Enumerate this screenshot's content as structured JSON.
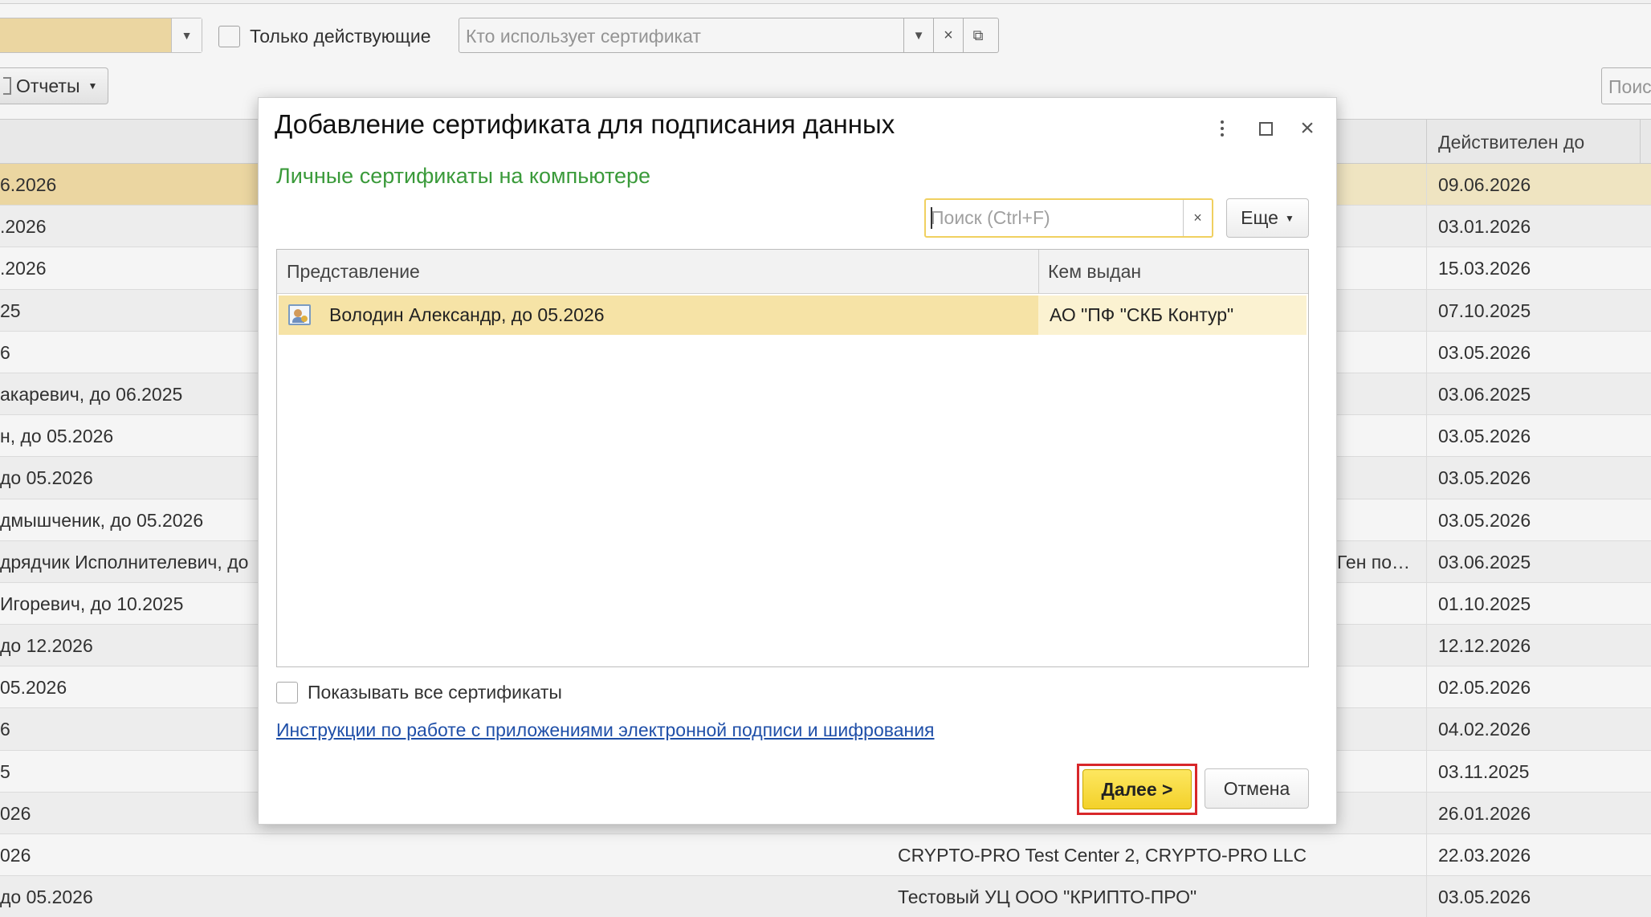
{
  "background": {
    "filter_only_active_label": "Только действующие",
    "who_uses_placeholder": "Кто использует сертификат",
    "reports_label": "Отчеты",
    "right_search_placeholder": "Поис",
    "valid_until_header": "Действителен до",
    "rows": [
      {
        "name": "6.2026",
        "issuer": "",
        "date": "09.06.2026",
        "selected": true
      },
      {
        "name": ".2026",
        "issuer": "",
        "date": "03.01.2026"
      },
      {
        "name": ".2026",
        "issuer": "",
        "date": "15.03.2026"
      },
      {
        "name": "25",
        "issuer": "",
        "date": "07.10.2025"
      },
      {
        "name": "6",
        "issuer": "",
        "date": "03.05.2026"
      },
      {
        "name": "акаревич, до 06.2025",
        "issuer": "",
        "date": "03.06.2025"
      },
      {
        "name": "н, до 05.2026",
        "issuer": "",
        "date": "03.05.2026"
      },
      {
        "name": "до 05.2026",
        "issuer": "",
        "date": "03.05.2026"
      },
      {
        "name": "дмышченик, до 05.2026",
        "issuer": "",
        "date": "03.05.2026"
      },
      {
        "name": "дрядчик Исполнителевич, до",
        "issuer": "Ген по…",
        "date": "03.06.2025",
        "issuer_right": true
      },
      {
        "name": "Игоревич, до 10.2025",
        "issuer": "",
        "date": "01.10.2025"
      },
      {
        "name": "до 12.2026",
        "issuer": "",
        "date": "12.12.2026"
      },
      {
        "name": " 05.2026",
        "issuer": "",
        "date": "02.05.2026"
      },
      {
        "name": "6",
        "issuer": "",
        "date": "04.02.2026"
      },
      {
        "name": "5",
        "issuer": "",
        "date": "03.11.2025"
      },
      {
        "name": "026",
        "issuer": "",
        "date": "26.01.2026"
      },
      {
        "name": "026",
        "issuer": "CRYPTO-PRO Test Center 2, CRYPTO-PRO LLC",
        "date": "22.03.2026"
      },
      {
        "name": "до 05.2026",
        "issuer": "Тестовый УЦ ООО \"КРИПТО-ПРО\"",
        "date": "03.05.2026"
      }
    ]
  },
  "dialog": {
    "title": "Добавление сертификата для подписания данных",
    "subtitle": "Личные сертификаты на компьютере",
    "search_placeholder": "Поиск (Ctrl+F)",
    "more_label": "Еще",
    "columns": {
      "presentation": "Представление",
      "issued_by": "Кем выдан"
    },
    "certificates": [
      {
        "presentation": "Володин Александр, до 05.2026",
        "issued_by": "АО \"ПФ \"СКБ Контур\""
      }
    ],
    "show_all_label": "Показывать все сертификаты",
    "instructions_link": "Инструкции по работе с приложениями электронной подписи и шифрования",
    "next_label": "Далее >",
    "cancel_label": "Отмена"
  },
  "colors": {
    "accent_yellow": "#f3d12a",
    "subtitle_green": "#3a9a3a",
    "link_blue": "#1f4fa8",
    "highlight_red": "#d8272a",
    "selection": "#f6e3a6"
  },
  "icons": {
    "dropdown": "chevron-down-icon",
    "clear": "close-icon",
    "open": "open-form-icon",
    "menu": "kebab-menu-icon",
    "maximize": "maximize-icon",
    "close": "close-icon",
    "certificate": "certificate-icon"
  }
}
